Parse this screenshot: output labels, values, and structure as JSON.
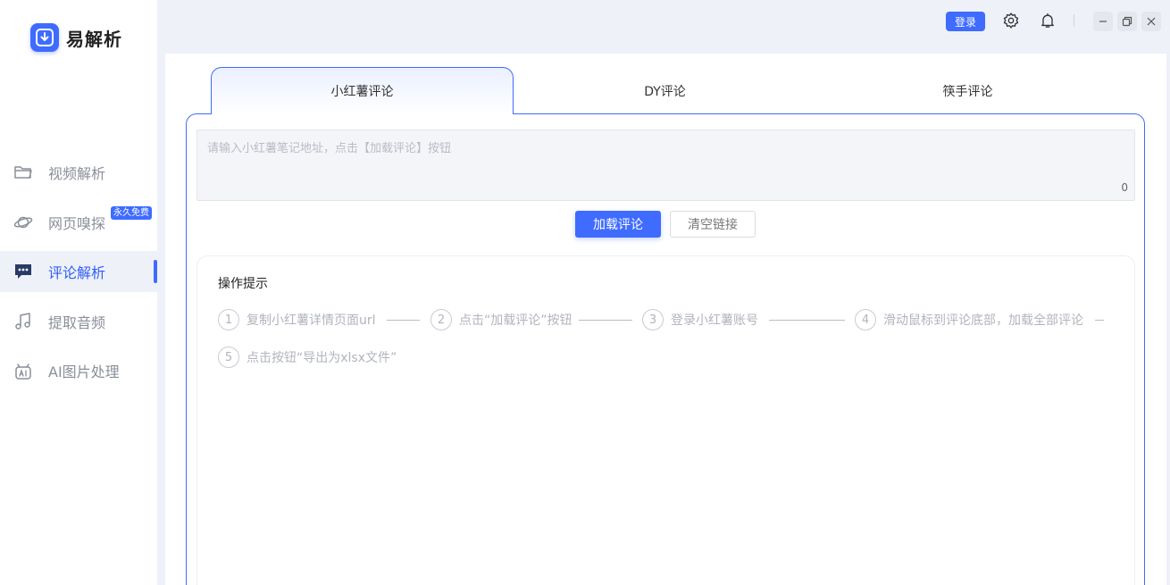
{
  "app": {
    "name": "易解析"
  },
  "sidebar": {
    "items": [
      {
        "label": "视频解析",
        "icon": "folder-icon"
      },
      {
        "label": "网页嗅探",
        "icon": "planet-icon",
        "badge": "永久免费"
      },
      {
        "label": "评论解析",
        "icon": "comment-icon",
        "active": true
      },
      {
        "label": "提取音频",
        "icon": "music-note-icon"
      },
      {
        "label": "AI图片处理",
        "icon": "ai-icon"
      }
    ]
  },
  "topbar": {
    "login_label": "登录"
  },
  "tabs": [
    {
      "label": "小红薯评论",
      "active": true
    },
    {
      "label": "DY评论"
    },
    {
      "label": "筷手评论"
    }
  ],
  "input": {
    "placeholder": "请输入小红薯笔记地址，点击【加载评论】按钮",
    "value": "",
    "count": "0"
  },
  "buttons": {
    "load": "加载评论",
    "clear": "清空链接"
  },
  "tips": {
    "title": "操作提示",
    "steps": [
      {
        "num": "1",
        "text": "复制小红薯详情页面url"
      },
      {
        "num": "2",
        "text": "点击“加载评论”按钮"
      },
      {
        "num": "3",
        "text": "登录小红薯账号"
      },
      {
        "num": "4",
        "text": "滑动鼠标到评论底部，加载全部评论"
      },
      {
        "num": "5",
        "text": "点击按钮“导出为xlsx文件”"
      }
    ]
  },
  "colors": {
    "accent": "#3f6bff",
    "background": "#eef1f8"
  }
}
